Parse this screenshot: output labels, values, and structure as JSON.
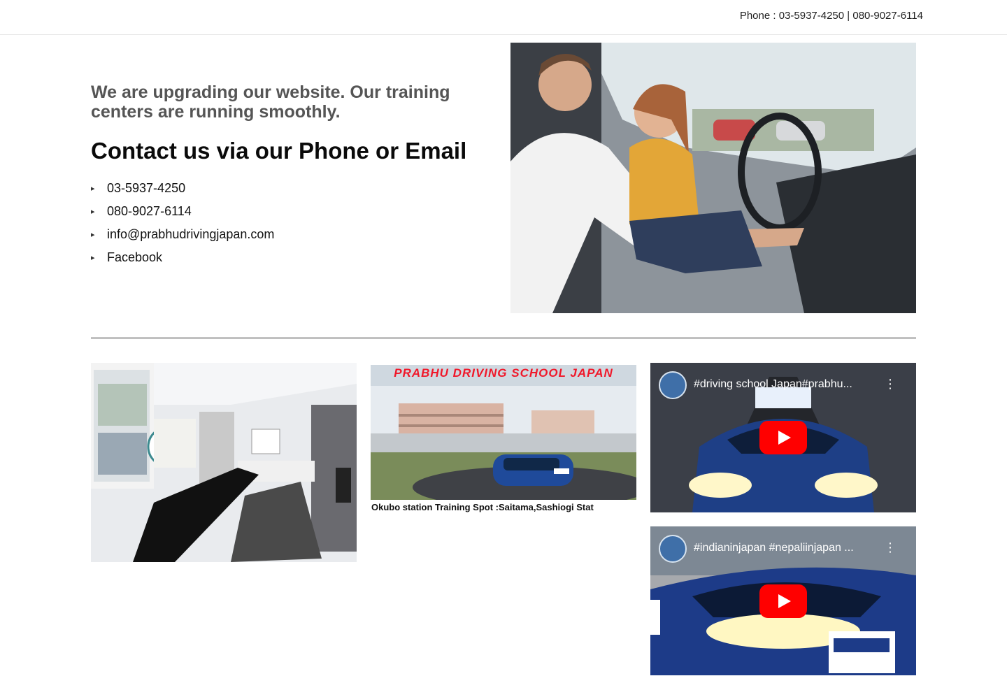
{
  "topbar": {
    "phone": "Phone : 03-5937-4250 | 080-9027-6114"
  },
  "hero": {
    "notice": "We are upgrading our website. Our training centers are running smoothly.",
    "heading": "Contact us via our Phone or Email",
    "contacts": [
      {
        "icon": "phone-icon",
        "text": "03-5937-4250"
      },
      {
        "icon": "mobile-icon",
        "text": "080-9027-6114"
      },
      {
        "icon": "envelope-icon",
        "text": "info@prabhudrivingjapan.com"
      },
      {
        "icon": "facebook-icon",
        "text": "Facebook"
      }
    ]
  },
  "gallery": {
    "school": {
      "title": "PRABHU DRIVING SCHOOL JAPAN",
      "caption": "Okubo station Training Spot :Saitama,Sashiogi Stat"
    },
    "videos": [
      {
        "title": "#driving school Japan#prabhu..."
      },
      {
        "title": "#indianinjapan #nepaliinjapan ..."
      }
    ]
  },
  "colors": {
    "youtube_red": "#ff0000",
    "school_title_red": "#f0182a",
    "notice_gray": "#555555"
  }
}
